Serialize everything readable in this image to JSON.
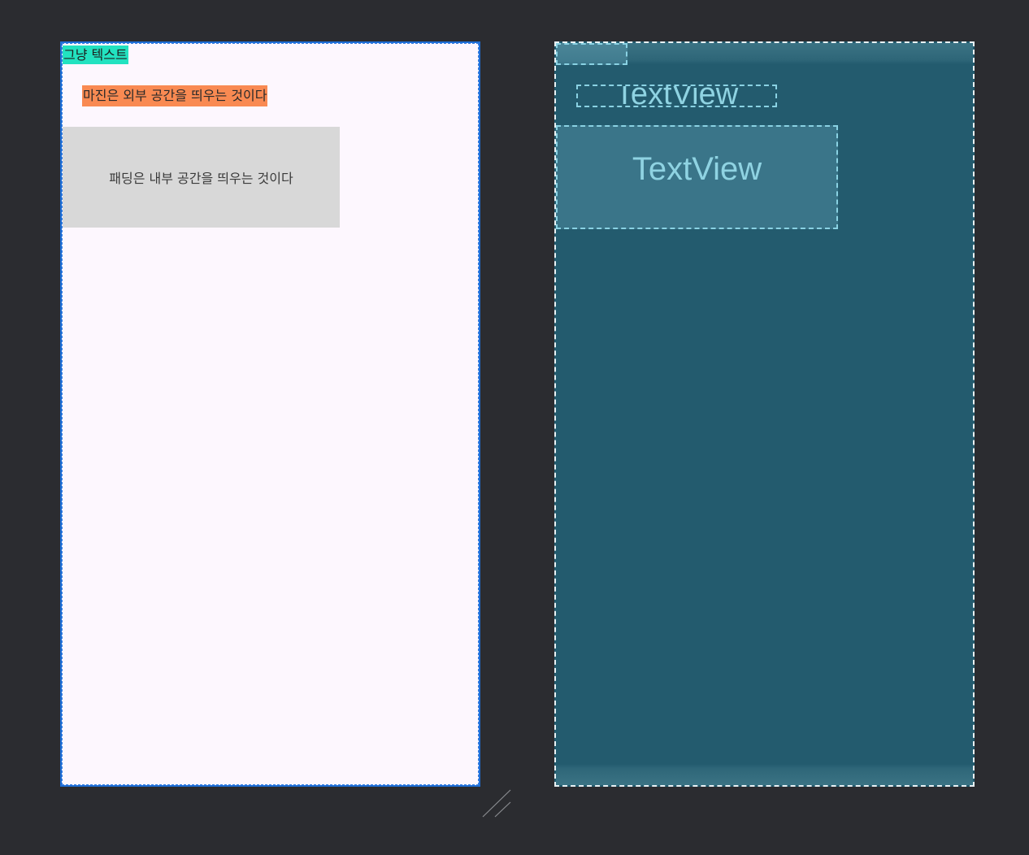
{
  "design": {
    "plain_text": "그냥 텍스트",
    "margin_text": "마진은 외부 공간을 띄우는 것이다",
    "padding_text": "패딩은 내부 공간을 띄우는 것이다"
  },
  "blueprint": {
    "view_1_label": "",
    "view_2_label": "TextView",
    "view_3_label": "TextView"
  },
  "colors": {
    "canvas_bg": "#2b2c30",
    "screen_bg": "#fdf7fe",
    "plain_text_bg": "#22e2c0",
    "margin_text_bg": "#f98a52",
    "padding_box_bg": "#d8d8d8",
    "blueprint_bg": "#235b6e",
    "blueprint_accent": "#8fd3e2",
    "selection": "#1f6fd6"
  },
  "icons": {
    "resize": "resize-handle-icon"
  }
}
